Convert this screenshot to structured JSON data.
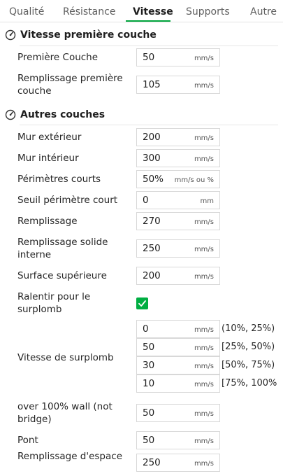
{
  "tabs": [
    {
      "label": "Qualité",
      "active": false
    },
    {
      "label": "Résistance",
      "active": false
    },
    {
      "label": "Vitesse",
      "active": true
    },
    {
      "label": "Supports",
      "active": false
    },
    {
      "label": "Autre",
      "active": false
    }
  ],
  "colors": {
    "accent": "#00ae42"
  },
  "sections": {
    "first_layer": {
      "title": "Vitesse première couche",
      "icon": "speedometer-icon",
      "rows": [
        {
          "label": "Première Couche",
          "value": "50",
          "unit": "mm/s"
        },
        {
          "label": "Remplissage première couche",
          "value": "105",
          "unit": "mm/s"
        }
      ]
    },
    "other_layers": {
      "title": "Autres couches",
      "icon": "speedometer-icon",
      "rows": [
        {
          "label": "Mur extérieur",
          "value": "200",
          "unit": "mm/s"
        },
        {
          "label": "Mur intérieur",
          "value": "300",
          "unit": "mm/s"
        },
        {
          "label": "Périmètres courts",
          "value": "50%",
          "unit": "mm/s ou %"
        },
        {
          "label": "Seuil périmètre court",
          "value": "0",
          "unit": "mm"
        },
        {
          "label": "Remplissage",
          "value": "270",
          "unit": "mm/s"
        },
        {
          "label": "Remplissage solide interne",
          "value": "250",
          "unit": "mm/s"
        },
        {
          "label": "Surface supérieure",
          "value": "200",
          "unit": "mm/s"
        }
      ],
      "slow_down_overhang": {
        "label": "Ralentir pour le surplomb",
        "checked": true
      },
      "overhang_speed": {
        "label": "Vitesse de surplomb",
        "rows": [
          {
            "value": "0",
            "unit": "mm/s",
            "range": "(10%, 25%)"
          },
          {
            "value": "50",
            "unit": "mm/s",
            "range": "[25%, 50%)"
          },
          {
            "value": "30",
            "unit": "mm/s",
            "range": "[50%, 75%)"
          },
          {
            "value": "10",
            "unit": "mm/s",
            "range": "[75%, 100%"
          }
        ]
      },
      "rows_after": [
        {
          "label": "over 100% wall (not bridge)",
          "value": "50",
          "unit": "mm/s"
        },
        {
          "label": "Pont",
          "value": "50",
          "unit": "mm/s"
        },
        {
          "label": "Remplissage d'espace",
          "value": "250",
          "unit": "mm/s"
        }
      ]
    }
  }
}
